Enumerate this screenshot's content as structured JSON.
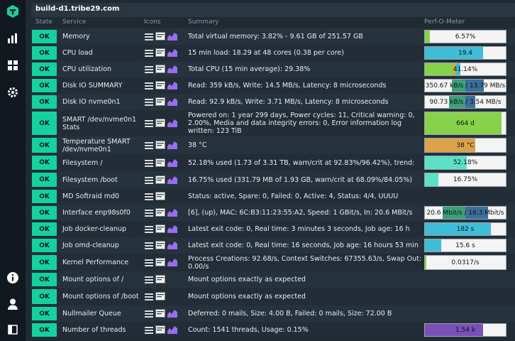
{
  "hostname": "build-d1.tribe29.com",
  "headers": {
    "state": "State",
    "service": "Service",
    "icons": "Icons",
    "summary": "Summary",
    "perf": "Perf-O-Meter"
  },
  "sidebar": {
    "icons": [
      "logo-icon",
      "dashboard-icon",
      "grid-icon",
      "settings-icon",
      "info-icon",
      "user-icon",
      "sidebar-toggle-icon"
    ]
  },
  "colors": {
    "ok": "#15d1a0",
    "cpu": "#3fbdd7",
    "mem": "#88d24b",
    "temp": "#d9a24b",
    "fs": "#5ce0c6",
    "threads": "#7b4fb8",
    "io": "#3c6e9a"
  },
  "rows": [
    {
      "state": "OK",
      "service": "Memory",
      "summary": "Total virtual memory: 3.82% - 9.61 GB of 251.57 GB",
      "perf": "6.57%",
      "graph": true
    },
    {
      "state": "OK",
      "service": "CPU load",
      "summary": "15 min load: 18.29 at 48 cores (0.38 per core)",
      "perf": "19.4",
      "graph": true
    },
    {
      "state": "OK",
      "service": "CPU utilization",
      "summary": "Total CPU (15 min average): 29.38%",
      "perf": "41.14%",
      "graph": true
    },
    {
      "state": "OK",
      "service": "Disk IO SUMMARY",
      "summary": "Read: 359 kB/s, Write: 14.5 MB/s, Latency: 8 microseconds",
      "perf": "350.67 kB/s / 13.79 MB/s",
      "graph": true
    },
    {
      "state": "OK",
      "service": "Disk IO nvme0n1",
      "summary": "Read: 92.9 kB/s, Write: 3.71 MB/s, Latency: 8 microseconds",
      "perf": "90.73 kB/s / 3.54 MB/s",
      "graph": true
    },
    {
      "state": "OK",
      "service": "SMART /dev/nvme0n1 Stats",
      "summary": "Powered on: 1 year 299 days, Power cycles: 11, Critical warning: 0, 2.00%, Media and data integrity errors: 0, Error information log written: 123 TiB",
      "perf": "664 d",
      "graph": true
    },
    {
      "state": "OK",
      "service": "Temperature SMART /dev/nvme0n1",
      "summary": "38 °C",
      "perf": "38 °C",
      "graph": true
    },
    {
      "state": "OK",
      "service": "Filesystem /",
      "summary": "52.18% used (1.73 of 3.31 TB, warn/crit at 92.83%/96.42%), trend:",
      "perf": "52.18%",
      "graph": true
    },
    {
      "state": "OK",
      "service": "Filesystem /boot",
      "summary": "16.75% used (331.79 MB of 1.93 GB, warn/crit at 68.09%/84.05%)",
      "perf": "16.75%",
      "graph": true
    },
    {
      "state": "OK",
      "service": "MD Softraid md0",
      "summary": "Status: active, Spare: 0, Failed: 0, Active: 4, Status: 4/4, UUUU",
      "perf": "",
      "graph": false
    },
    {
      "state": "OK",
      "service": "Interface enp98s0f0",
      "summary": "[6], (up), MAC: 6C:B3:11:23:55:A2, Speed: 1 GBit/s, In: 20.6 MBit/s",
      "perf": "20.6 Mbit/s / 16.3 Mbit/s",
      "graph": true
    },
    {
      "state": "OK",
      "service": "Job docker-cleanup",
      "summary": "Latest exit code: 0, Real time: 3 minutes 3 seconds, Job age: 16 h",
      "perf": "182 s",
      "graph": true
    },
    {
      "state": "OK",
      "service": "Job omd-cleanup",
      "summary": "Latest exit code: 0, Real time: 16 seconds, Job age: 16 hours 53 min",
      "perf": "15.6 s",
      "graph": true
    },
    {
      "state": "OK",
      "service": "Kernel Performance",
      "summary": "Process Creations: 92.68/s, Context Switches: 67355.63/s, Swap Out: 0.00/s",
      "perf": "0.0317/s",
      "graph": true
    },
    {
      "state": "OK",
      "service": "Mount options of /",
      "summary": "Mount options exactly as expected",
      "perf": "",
      "graph": false
    },
    {
      "state": "OK",
      "service": "Mount options of /boot",
      "summary": "Mount options exactly as expected",
      "perf": "",
      "graph": false
    },
    {
      "state": "OK",
      "service": "Nullmailer Queue",
      "summary": "Deferred: 0 mails, Size: 4.00 B, Failed: 0 mails, Size: 72.00 B",
      "perf": "",
      "graph": true
    },
    {
      "state": "OK",
      "service": "Number of threads",
      "summary": "Count: 1541 threads, Usage: 0.15%",
      "perf": "1.54 k",
      "graph": true
    }
  ],
  "perf_bars": [
    {
      "segments": [
        {
          "from": 0,
          "to": 0.06,
          "color": "#88d24b"
        }
      ]
    },
    {
      "segments": [
        {
          "from": 0,
          "to": 0.72,
          "color": "#3fbdd7"
        }
      ]
    },
    {
      "segments": [
        {
          "from": 0,
          "to": 0.35,
          "color": "#88d24b"
        },
        {
          "from": 0.35,
          "to": 0.39,
          "color": "#d9a24b"
        },
        {
          "from": 0.39,
          "to": 0.44,
          "color": "#3fbdd7"
        }
      ]
    },
    {
      "segments": [
        {
          "from": 0.33,
          "to": 0.5,
          "color": "#3b9f7a"
        },
        {
          "from": 0.5,
          "to": 0.73,
          "color": "#3c6e9a"
        }
      ]
    },
    {
      "segments": [
        {
          "from": 0.3,
          "to": 0.5,
          "color": "#3b9f7a"
        },
        {
          "from": 0.5,
          "to": 0.62,
          "color": "#3c6e9a"
        }
      ]
    },
    {
      "segments": [
        {
          "from": 0,
          "to": 0.95,
          "color": "#88d24b"
        }
      ]
    },
    {
      "segments": [
        {
          "from": 0,
          "to": 0.62,
          "color": "#d9a24b"
        }
      ]
    },
    {
      "segments": [
        {
          "from": 0,
          "to": 0.52,
          "color": "#5ce0c6"
        }
      ]
    },
    {
      "segments": [
        {
          "from": 0,
          "to": 0.17,
          "color": "#5ce0c6"
        }
      ]
    },
    {
      "segments": []
    },
    {
      "segments": [
        {
          "from": 0.22,
          "to": 0.5,
          "color": "#3b9f7a"
        },
        {
          "from": 0.5,
          "to": 0.78,
          "color": "#3c6e9a"
        }
      ]
    },
    {
      "segments": [
        {
          "from": 0,
          "to": 0.82,
          "color": "#3fbdd7"
        }
      ]
    },
    {
      "segments": [
        {
          "from": 0,
          "to": 0.2,
          "color": "#3fbdd7"
        }
      ]
    },
    {
      "segments": [
        {
          "from": 0,
          "to": 0.02,
          "color": "#88d24b"
        }
      ]
    },
    {
      "segments": []
    },
    {
      "segments": []
    },
    {
      "segments": []
    },
    {
      "segments": [
        {
          "from": 0,
          "to": 0.72,
          "color": "#7b4fb8"
        }
      ]
    }
  ]
}
